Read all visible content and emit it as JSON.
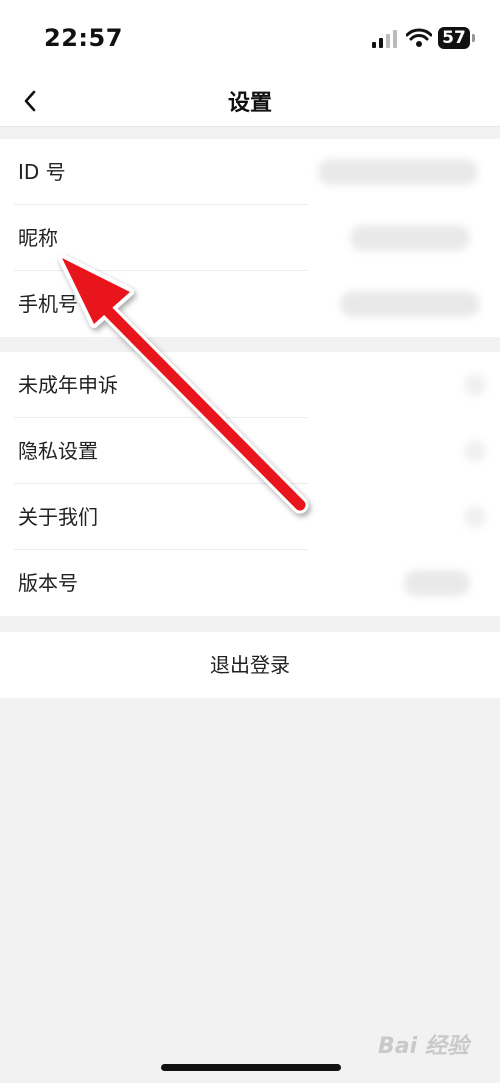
{
  "status_bar": {
    "time": "22:57",
    "battery": "57"
  },
  "nav": {
    "title": "设置"
  },
  "group1": {
    "items": [
      {
        "label": "ID 号"
      },
      {
        "label": "昵称"
      },
      {
        "label": "手机号"
      }
    ]
  },
  "group2": {
    "items": [
      {
        "label": "未成年申诉"
      },
      {
        "label": "隐私设置"
      },
      {
        "label": "关于我们"
      },
      {
        "label": "版本号"
      }
    ]
  },
  "logout": {
    "label": "退出登录"
  },
  "watermark": {
    "text": "Bai 经验"
  },
  "colors": {
    "arrow": "#e8141b",
    "background": "#f2f2f2",
    "card": "#ffffff"
  },
  "icons": [
    "back-chevron-icon",
    "signal-icon",
    "wifi-icon",
    "battery-icon"
  ]
}
